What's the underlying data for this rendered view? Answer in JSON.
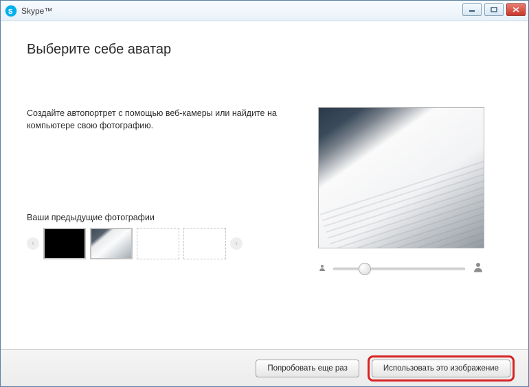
{
  "window": {
    "title": "Skype™"
  },
  "page": {
    "heading": "Выберите себе аватар",
    "description": "Создайте автопортрет с помощью веб-камеры или найдите на компьютере свою фотографию.",
    "previousLabel": "Ваши предыдущие фотографии"
  },
  "zoom": {
    "value": 24,
    "min": 0,
    "max": 100
  },
  "buttons": {
    "retry": "Попробовать еще раз",
    "use": "Использовать это изображение"
  }
}
